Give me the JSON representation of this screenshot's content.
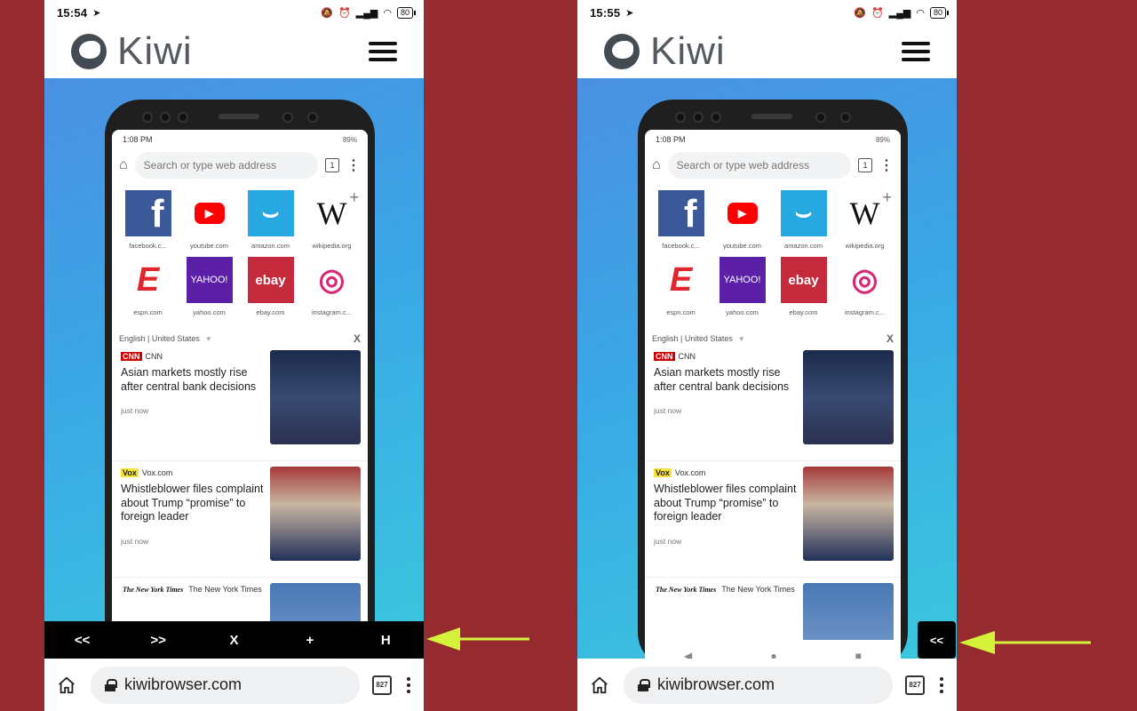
{
  "colors": {
    "background": "#952b2e",
    "arrow": "#d4f23a",
    "toolbar": "#000000"
  },
  "screens": [
    {
      "status": {
        "time": "15:54",
        "battery": "80"
      },
      "site": {
        "logo_text": "Kiwi"
      },
      "browser": {
        "url": "kiwibrowser.com",
        "tab_count": "827"
      }
    },
    {
      "status": {
        "time": "15:55",
        "battery": "80"
      },
      "site": {
        "logo_text": "Kiwi"
      },
      "browser": {
        "url": "kiwibrowser.com",
        "tab_count": "827"
      }
    }
  ],
  "mockup": {
    "status_time": "1:08 PM",
    "battery": "89%",
    "search_placeholder": "Search or type web address",
    "tab_count": "1",
    "tiles": [
      {
        "label": "facebook.c...",
        "icon": "facebook-icon",
        "glyph": "f"
      },
      {
        "label": "youtube.com",
        "icon": "youtube-icon",
        "glyph": "▶"
      },
      {
        "label": "amazon.com",
        "icon": "amazon-icon",
        "glyph": "⌣"
      },
      {
        "label": "wikipedia.org",
        "icon": "wikipedia-icon",
        "glyph": "W"
      },
      {
        "label": "espn.com",
        "icon": "espn-icon",
        "glyph": "E"
      },
      {
        "label": "yahoo.com",
        "icon": "yahoo-icon",
        "glyph": "YAHOO!"
      },
      {
        "label": "ebay.com",
        "icon": "ebay-icon",
        "glyph": "ebay"
      },
      {
        "label": "instagram.c...",
        "icon": "instagram-icon",
        "glyph": "◎"
      }
    ],
    "language": "English | United States",
    "close": "X",
    "articles": [
      {
        "source": "CNN",
        "logo": "CNN",
        "headline": "Asian markets mostly rise after central bank decisions",
        "time": "just now"
      },
      {
        "source": "Vox.com",
        "logo": "Vox",
        "headline": "Whistleblower files complaint about Trump “promise” to foreign leader",
        "time": "just now"
      },
      {
        "source": "The New York Times",
        "logo": "The New York Times"
      }
    ]
  },
  "toolbar": {
    "back": "<<",
    "forward": ">>",
    "close": "X",
    "add": "+",
    "hide": "H"
  },
  "collapsed_button": {
    "label": "<<"
  }
}
